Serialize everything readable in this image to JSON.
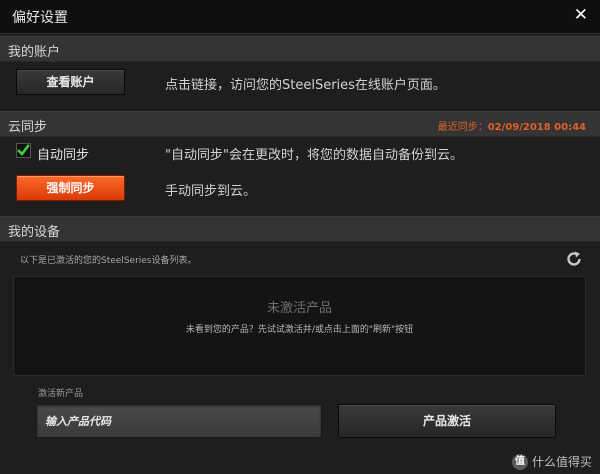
{
  "window": {
    "title": "偏好设置",
    "close_glyph": "✕"
  },
  "account": {
    "header": "我的账户",
    "view_button": "查看账户",
    "description": "点击链接，访问您的SteelSeries在线账户页面。"
  },
  "sync": {
    "header": "云同步",
    "last_sync_label": "最近同步：",
    "last_sync_time": "02/09/2018 00:44",
    "auto_sync_label": "自动同步",
    "auto_sync_checked": true,
    "auto_sync_description": "\"自动同步\"会在更改时，将您的数据自动备份到云。",
    "force_button": "强制同步",
    "force_description": "手动同步到云。"
  },
  "devices": {
    "header": "我的设备",
    "note": "以下是已激活的您的SteelSeries设备列表。",
    "empty_title": "未激活产品",
    "empty_hint": "未看到您的产品？先试试激活并/或点击上面的\"刷新\"按钮",
    "activate_label": "激活新产品",
    "code_placeholder": "输入产品代码",
    "activate_button": "产品激活"
  },
  "watermark": {
    "badge": "值",
    "text": "什么值得买"
  },
  "colors": {
    "accent": "#e8491a",
    "sync_time": "#e0602a",
    "background": "#1e1e1e"
  }
}
